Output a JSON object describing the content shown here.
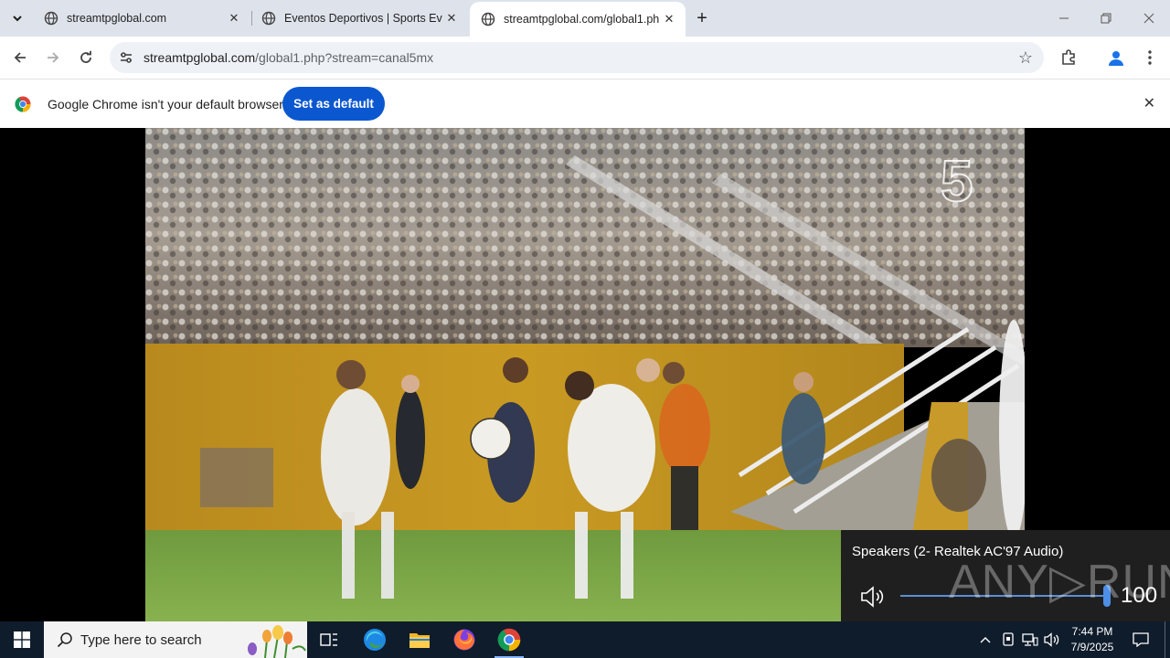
{
  "tabs": [
    {
      "title": "streamtpglobal.com"
    },
    {
      "title": "Eventos Deportivos | Sports Eve"
    },
    {
      "title": "streamtpglobal.com/global1.ph"
    }
  ],
  "address_bar": {
    "host": "streamtpglobal.com",
    "path": "/global1.php?stream=canal5mx"
  },
  "infobar": {
    "message": "Google Chrome isn't your default browser",
    "button": "Set as default"
  },
  "video": {
    "channel_logo": "5"
  },
  "volume_flyout": {
    "device": "Speakers (2- Realtek AC'97 Audio)",
    "level": "100",
    "level_fraction": 1.0
  },
  "watermark": {
    "text": "ANY▷RUN"
  },
  "taskbar": {
    "search_placeholder": "Type here to search"
  },
  "clock": {
    "time": "7:44 PM",
    "date": "7/9/2025"
  },
  "colors": {
    "accent": "#0b57d0",
    "tabstrip": "#dee3eb",
    "taskbar": "#0f1c2c"
  }
}
